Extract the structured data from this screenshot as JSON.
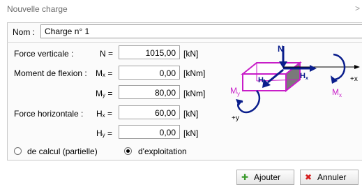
{
  "window": {
    "title": "Nouvelle charge",
    "close_glyph": ">"
  },
  "name": {
    "label": "Nom :",
    "value": "Charge n° 1"
  },
  "rows": [
    {
      "label": "Force verticale :",
      "symbol": "N",
      "sub": "",
      "value": "1015,00",
      "unit": "[kN]"
    },
    {
      "label": "Moment de flexion :",
      "symbol": "M",
      "sub": "x",
      "value": "0,00",
      "unit": "[kNm]"
    },
    {
      "label": "",
      "symbol": "M",
      "sub": "y",
      "value": "80,00",
      "unit": "[kNm]"
    },
    {
      "label": "Force horizontale :",
      "symbol": "H",
      "sub": "x",
      "value": "60,00",
      "unit": "[kN]"
    },
    {
      "label": "",
      "symbol": "H",
      "sub": "y",
      "value": "0,00",
      "unit": "[kN]"
    }
  ],
  "load_type": {
    "options": [
      "de calcul (partielle)",
      "d'exploitation"
    ],
    "selected": "d'exploitation"
  },
  "diagram": {
    "labels": {
      "N": "N",
      "Mx": "M",
      "Mx_sub": "x",
      "My": "M",
      "My_sub": "y",
      "Hx": "H",
      "Hx_sub": "x",
      "Hy": "H",
      "Hy_sub": "y",
      "plus_x": "+x",
      "plus_y": "+y"
    },
    "colors": {
      "force": "#0a1e8c",
      "block": "#c81ec8",
      "block_dark": "#7a7a7a"
    }
  },
  "buttons": {
    "add": "Ajouter",
    "cancel": "Annuler"
  }
}
